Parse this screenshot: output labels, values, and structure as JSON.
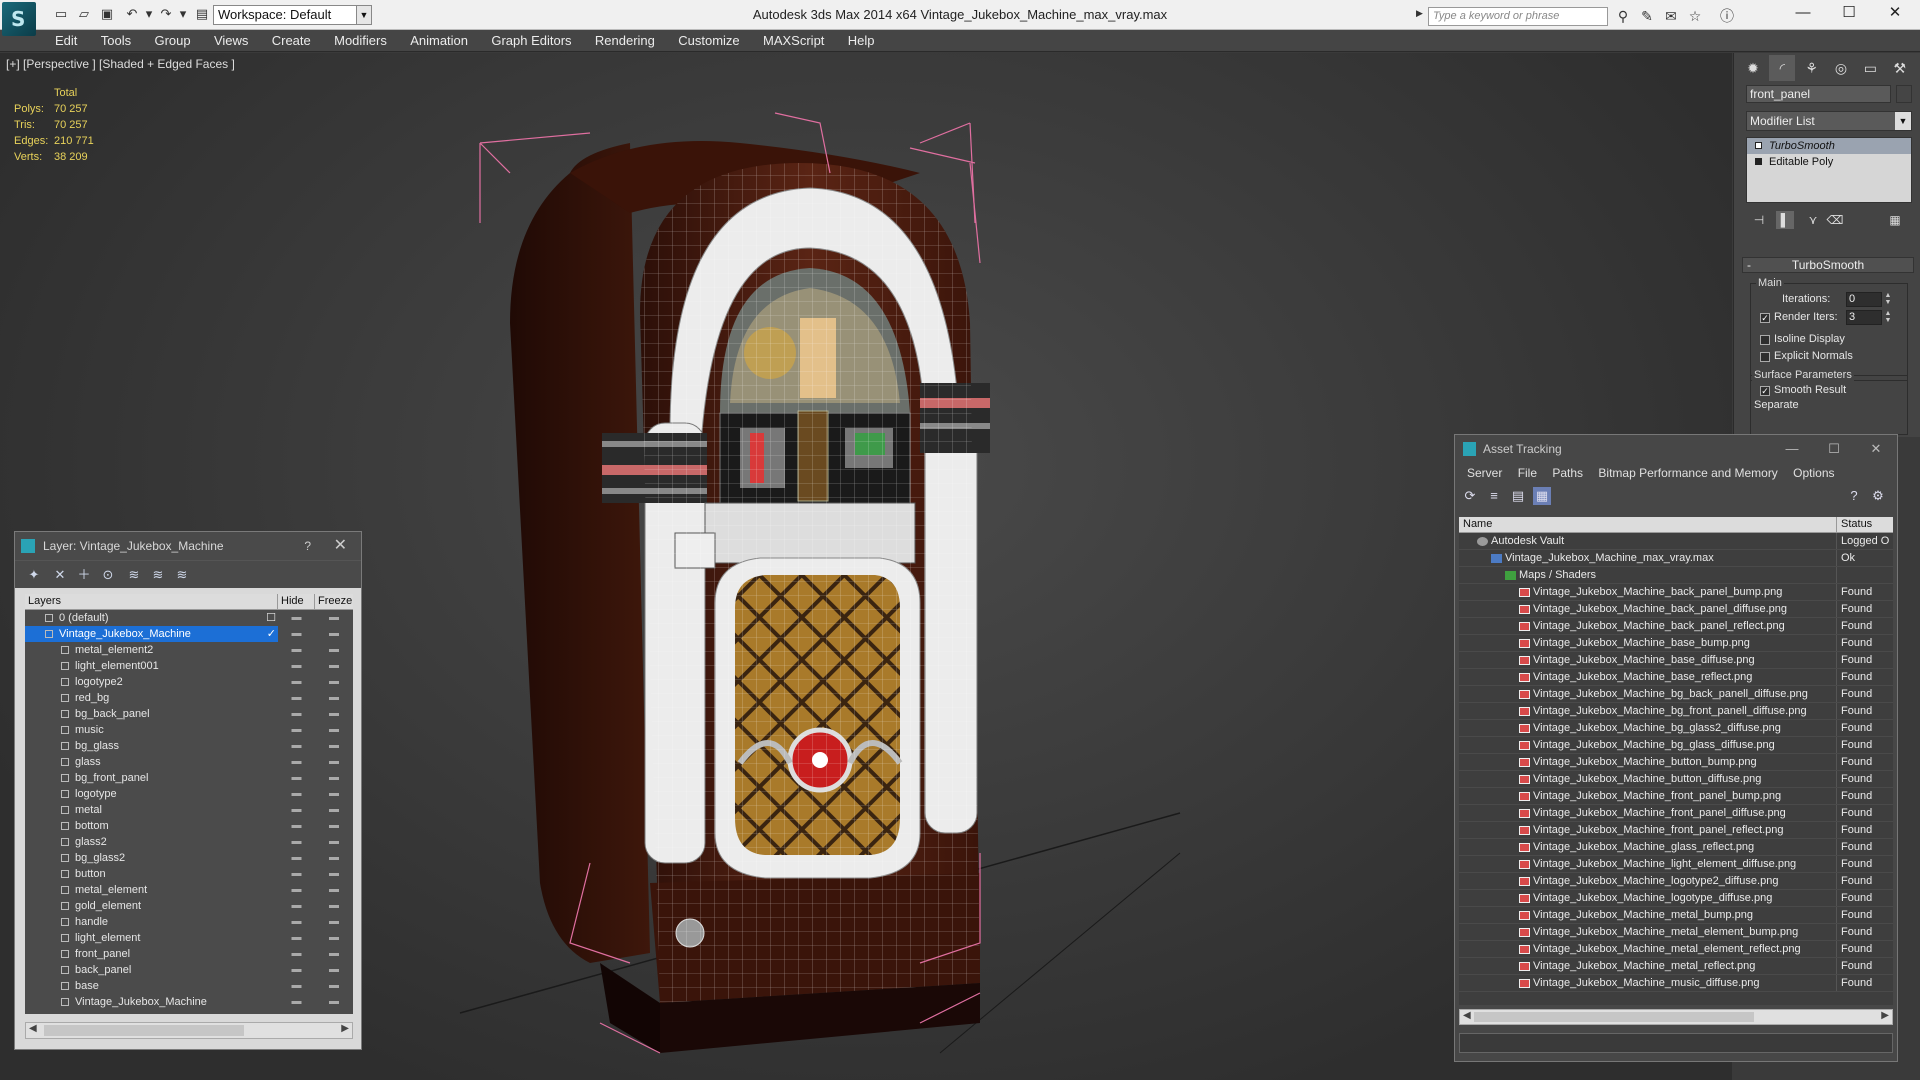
{
  "titlebar": {
    "logo": "S",
    "workspace": "Workspace: Default",
    "app_title": "Autodesk 3ds Max  2014 x64      Vintage_Jukebox_Machine_max_vray.max",
    "search_placeholder": "Type a keyword or phrase",
    "minimize": "—",
    "maximize": "☐",
    "close": "✕"
  },
  "menu": [
    "Edit",
    "Tools",
    "Group",
    "Views",
    "Create",
    "Modifiers",
    "Animation",
    "Graph Editors",
    "Rendering",
    "Customize",
    "MAXScript",
    "Help"
  ],
  "viewport": {
    "label": "[+] [Perspective ] [Shaded + Edged Faces ]",
    "stats": {
      "header": "Total",
      "rows": [
        {
          "k": "Polys:",
          "v": "70 257"
        },
        {
          "k": "Tris:",
          "v": "70 257"
        },
        {
          "k": "Edges:",
          "v": "210 771"
        },
        {
          "k": "Verts:",
          "v": "38 209"
        }
      ]
    }
  },
  "layer_panel": {
    "title": "Layer: Vintage_Jukebox_Machine",
    "help": "?",
    "close": "✕",
    "columns": {
      "layers": "Layers",
      "hide": "Hide",
      "freeze": "Freeze"
    },
    "rows": [
      {
        "name": "0 (default)",
        "top": true,
        "hide": "",
        "frz": "",
        "mark": "☐"
      },
      {
        "name": "Vintage_Jukebox_Machine",
        "top": true,
        "sel": true,
        "mark": "✓"
      },
      {
        "name": "metal_element2"
      },
      {
        "name": "light_element001"
      },
      {
        "name": "logotype2"
      },
      {
        "name": "red_bg"
      },
      {
        "name": "bg_back_panel"
      },
      {
        "name": "music"
      },
      {
        "name": "bg_glass"
      },
      {
        "name": "glass"
      },
      {
        "name": "bg_front_panel"
      },
      {
        "name": "logotype"
      },
      {
        "name": "metal"
      },
      {
        "name": "bottom"
      },
      {
        "name": "glass2"
      },
      {
        "name": "bg_glass2"
      },
      {
        "name": "button"
      },
      {
        "name": "metal_element"
      },
      {
        "name": "gold_element"
      },
      {
        "name": "handle"
      },
      {
        "name": "light_element"
      },
      {
        "name": "front_panel"
      },
      {
        "name": "back_panel"
      },
      {
        "name": "base"
      },
      {
        "name": "Vintage_Jukebox_Machine"
      }
    ]
  },
  "command_panel": {
    "object_name": "front_panel",
    "modifier_list": "Modifier List",
    "stack": [
      "TurboSmooth",
      "Editable Poly"
    ],
    "rollout_title": "TurboSmooth",
    "main_group": "Main",
    "iterations_label": "Iterations:",
    "iterations_value": "0",
    "render_iters_label": "Render Iters:",
    "render_iters_value": "3",
    "render_iters_checked": true,
    "isoline_label": "Isoline Display",
    "explicit_label": "Explicit Normals",
    "surface_group": "Surface Parameters",
    "smooth_label": "Smooth Result",
    "smooth_checked": true,
    "separate_label": "Separate"
  },
  "asset_panel": {
    "title": "Asset Tracking",
    "menu": [
      "Server",
      "File",
      "Paths",
      "Bitmap Performance and Memory",
      "Options"
    ],
    "columns": {
      "name": "Name",
      "status": "Status"
    },
    "rows": [
      {
        "name": "Autodesk Vault",
        "status": "Logged O",
        "indent": 0,
        "icon": "vault"
      },
      {
        "name": "Vintage_Jukebox_Machine_max_vray.max",
        "status": "Ok",
        "indent": 1,
        "icon": "file"
      },
      {
        "name": "Maps / Shaders",
        "status": "",
        "indent": 2,
        "icon": "maps"
      },
      {
        "name": "Vintage_Jukebox_Machine_back_panel_bump.png",
        "status": "Found",
        "indent": 3,
        "icon": "png"
      },
      {
        "name": "Vintage_Jukebox_Machine_back_panel_diffuse.png",
        "status": "Found",
        "indent": 3,
        "icon": "png"
      },
      {
        "name": "Vintage_Jukebox_Machine_back_panel_reflect.png",
        "status": "Found",
        "indent": 3,
        "icon": "png"
      },
      {
        "name": "Vintage_Jukebox_Machine_base_bump.png",
        "status": "Found",
        "indent": 3,
        "icon": "png"
      },
      {
        "name": "Vintage_Jukebox_Machine_base_diffuse.png",
        "status": "Found",
        "indent": 3,
        "icon": "png"
      },
      {
        "name": "Vintage_Jukebox_Machine_base_reflect.png",
        "status": "Found",
        "indent": 3,
        "icon": "png"
      },
      {
        "name": "Vintage_Jukebox_Machine_bg_back_panell_diffuse.png",
        "status": "Found",
        "indent": 3,
        "icon": "png"
      },
      {
        "name": "Vintage_Jukebox_Machine_bg_front_panell_diffuse.png",
        "status": "Found",
        "indent": 3,
        "icon": "png"
      },
      {
        "name": "Vintage_Jukebox_Machine_bg_glass2_diffuse.png",
        "status": "Found",
        "indent": 3,
        "icon": "png"
      },
      {
        "name": "Vintage_Jukebox_Machine_bg_glass_diffuse.png",
        "status": "Found",
        "indent": 3,
        "icon": "png"
      },
      {
        "name": "Vintage_Jukebox_Machine_button_bump.png",
        "status": "Found",
        "indent": 3,
        "icon": "png"
      },
      {
        "name": "Vintage_Jukebox_Machine_button_diffuse.png",
        "status": "Found",
        "indent": 3,
        "icon": "png"
      },
      {
        "name": "Vintage_Jukebox_Machine_front_panel_bump.png",
        "status": "Found",
        "indent": 3,
        "icon": "png"
      },
      {
        "name": "Vintage_Jukebox_Machine_front_panel_diffuse.png",
        "status": "Found",
        "indent": 3,
        "icon": "png"
      },
      {
        "name": "Vintage_Jukebox_Machine_front_panel_reflect.png",
        "status": "Found",
        "indent": 3,
        "icon": "png"
      },
      {
        "name": "Vintage_Jukebox_Machine_glass_reflect.png",
        "status": "Found",
        "indent": 3,
        "icon": "png"
      },
      {
        "name": "Vintage_Jukebox_Machine_light_element_diffuse.png",
        "status": "Found",
        "indent": 3,
        "icon": "png"
      },
      {
        "name": "Vintage_Jukebox_Machine_logotype2_diffuse.png",
        "status": "Found",
        "indent": 3,
        "icon": "png"
      },
      {
        "name": "Vintage_Jukebox_Machine_logotype_diffuse.png",
        "status": "Found",
        "indent": 3,
        "icon": "png"
      },
      {
        "name": "Vintage_Jukebox_Machine_metal_bump.png",
        "status": "Found",
        "indent": 3,
        "icon": "png"
      },
      {
        "name": "Vintage_Jukebox_Machine_metal_element_bump.png",
        "status": "Found",
        "indent": 3,
        "icon": "png"
      },
      {
        "name": "Vintage_Jukebox_Machine_metal_element_reflect.png",
        "status": "Found",
        "indent": 3,
        "icon": "png"
      },
      {
        "name": "Vintage_Jukebox_Machine_metal_reflect.png",
        "status": "Found",
        "indent": 3,
        "icon": "png"
      },
      {
        "name": "Vintage_Jukebox_Machine_music_diffuse.png",
        "status": "Found",
        "indent": 3,
        "icon": "png"
      }
    ]
  },
  "colors": {
    "selection": "#1c6fd6",
    "stats_text": "#e8d25a",
    "bbox": "#e06fa0",
    "wood": "#4a1d10"
  }
}
